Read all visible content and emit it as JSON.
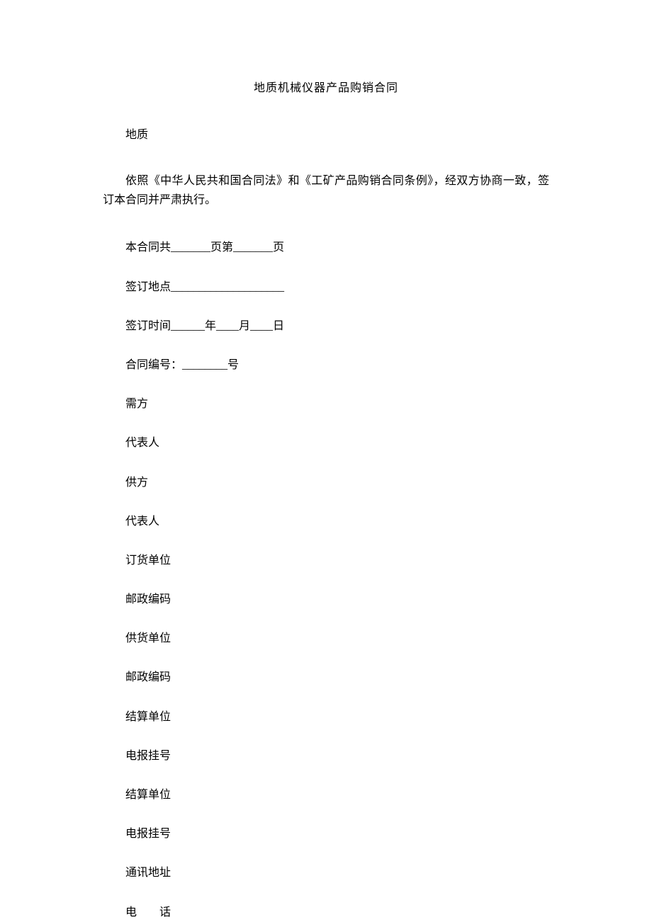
{
  "title": "地质机械仪器产品购销合同",
  "firstLine": "地质",
  "intro": "依照《中华人民共和国合同法》和《工矿产品购销合同条例》，经双方协商一致，签订本合同并严肃执行。",
  "lines": {
    "l1": "本合同共_______页第_______页",
    "l2": "签订地点____________________",
    "l3": "签订时间______年____月____日",
    "l4": "合同编号：________号",
    "l5": "需方",
    "l6": "代表人",
    "l7": "供方",
    "l8": "代表人",
    "l9": "订货单位",
    "l10": "邮政编码",
    "l11": "供货单位",
    "l12": "邮政编码",
    "l13": "结算单位",
    "l14": "电报挂号",
    "l15": "结算单位",
    "l16": "电报挂号",
    "l17": "通讯地址",
    "l18": "电　　话"
  }
}
